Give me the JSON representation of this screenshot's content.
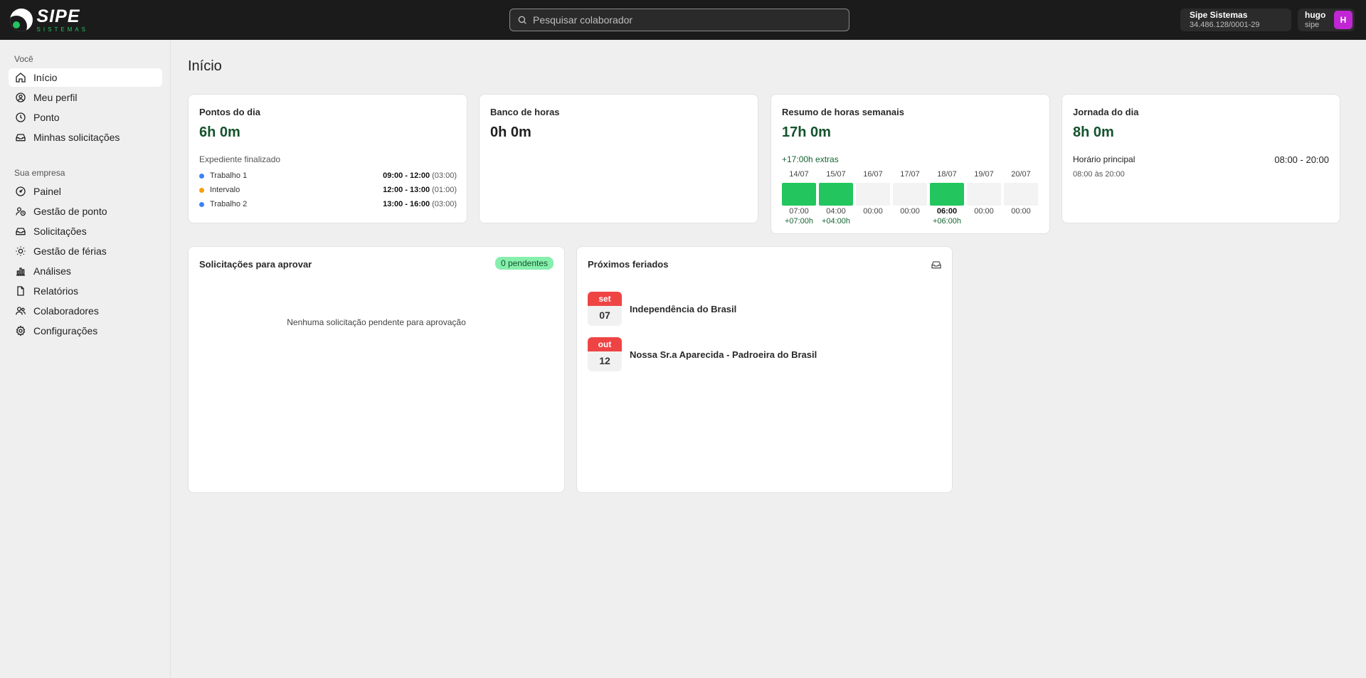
{
  "brand": {
    "logo_text": "SIPE",
    "logo_subtext": "SISTEMAS"
  },
  "search": {
    "placeholder": "Pesquisar colaborador"
  },
  "company": {
    "name": "Sipe Sistemas",
    "cnpj": "34.486.128/0001-29"
  },
  "user": {
    "name": "hugo",
    "company": "sipe",
    "initial": "H",
    "avatar_color": "#c026d3"
  },
  "sidebar": {
    "section_you": "Você",
    "you_items": [
      {
        "label": "Início",
        "icon": "home-icon"
      },
      {
        "label": "Meu perfil",
        "icon": "user-circle-icon"
      },
      {
        "label": "Ponto",
        "icon": "clock-icon"
      },
      {
        "label": "Minhas solicitações",
        "icon": "inbox-icon"
      }
    ],
    "section_company": "Sua empresa",
    "company_items": [
      {
        "label": "Painel",
        "icon": "gauge-icon"
      },
      {
        "label": "Gestão de ponto",
        "icon": "users-clock-icon"
      },
      {
        "label": "Solicitações",
        "icon": "inbox-icon"
      },
      {
        "label": "Gestão de férias",
        "icon": "sun-icon"
      },
      {
        "label": "Análises",
        "icon": "bar-chart-icon"
      },
      {
        "label": "Relatórios",
        "icon": "file-icon"
      },
      {
        "label": "Colaboradores",
        "icon": "users-icon"
      },
      {
        "label": "Configurações",
        "icon": "gear-icon"
      }
    ]
  },
  "main": {
    "title": "Início",
    "punches": {
      "title": "Pontos do dia",
      "total": "6h 0m",
      "status": "Expediente finalizado",
      "rows": [
        {
          "label": "Trabalho 1",
          "range": "09:00 - 12:00",
          "duration": "(03:00)",
          "color": "#3b82f6"
        },
        {
          "label": "Intervalo",
          "range": "12:00 - 13:00",
          "duration": "(01:00)",
          "color": "#f59e0b"
        },
        {
          "label": "Trabalho 2",
          "range": "13:00 - 16:00",
          "duration": "(03:00)",
          "color": "#3b82f6"
        }
      ]
    },
    "bank": {
      "title": "Banco de horas",
      "value": "0h 0m"
    },
    "weekly": {
      "title": "Resumo de horas semanais",
      "total": "17h 0m",
      "extras": "+17:00h extras",
      "days": [
        {
          "date": "14/07",
          "hours": "07:00",
          "extra": "+07:00h",
          "filled": true,
          "bold": false
        },
        {
          "date": "15/07",
          "hours": "04:00",
          "extra": "+04:00h",
          "filled": true,
          "bold": false
        },
        {
          "date": "16/07",
          "hours": "00:00",
          "extra": "",
          "filled": false,
          "bold": false
        },
        {
          "date": "17/07",
          "hours": "00:00",
          "extra": "",
          "filled": false,
          "bold": false
        },
        {
          "date": "18/07",
          "hours": "06:00",
          "extra": "+06:00h",
          "filled": true,
          "bold": true
        },
        {
          "date": "19/07",
          "hours": "00:00",
          "extra": "",
          "filled": false,
          "bold": false
        },
        {
          "date": "20/07",
          "hours": "00:00",
          "extra": "",
          "filled": false,
          "bold": false
        }
      ]
    },
    "journey": {
      "title": "Jornada do dia",
      "total": "8h 0m",
      "schedule_label": "Horário principal",
      "schedule_range": "08:00 - 20:00",
      "schedule_detail": "08:00 às 20:00"
    },
    "approvals": {
      "title": "Solicitações para aprovar",
      "badge": "0 pendentes",
      "empty": "Nenhuma solicitação pendente para aprovação"
    },
    "holidays": {
      "title": "Próximos feriados",
      "items": [
        {
          "month": "set",
          "day": "07",
          "name": "Independência do Brasil"
        },
        {
          "month": "out",
          "day": "12",
          "name": "Nossa Sr.a Aparecida - Padroeira do Brasil"
        }
      ]
    }
  }
}
